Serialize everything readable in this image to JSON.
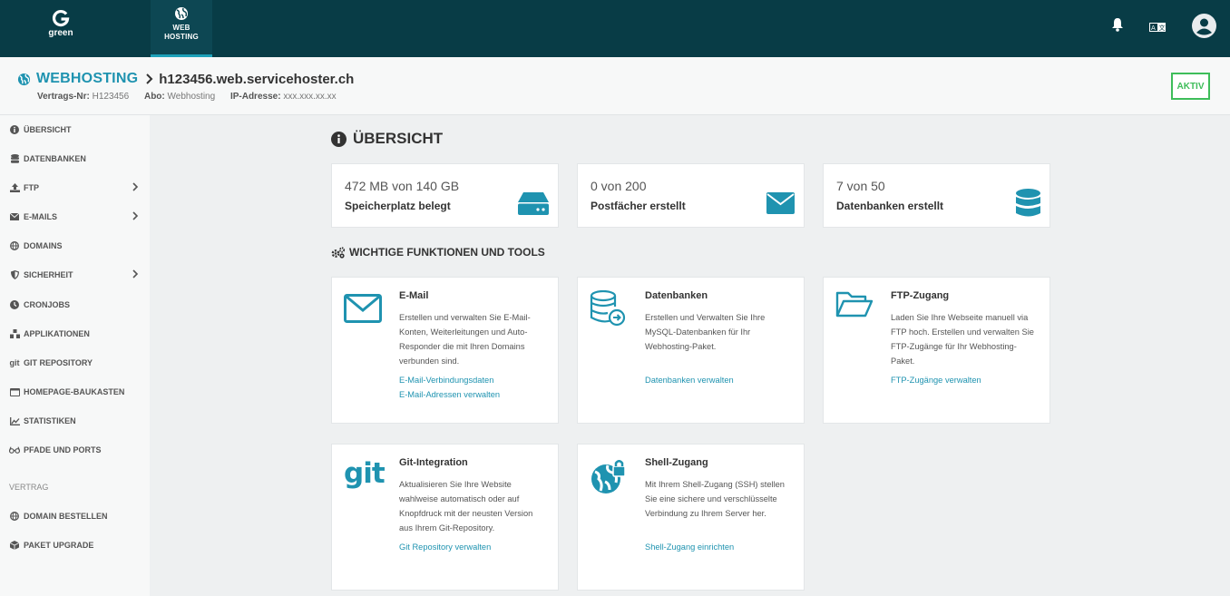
{
  "topbar": {
    "logo_text": "green",
    "nav_label_line1": "WEB",
    "nav_label_line2": "HOSTING"
  },
  "header": {
    "root": "WEBHOSTING",
    "host": "h123456.web.servicehoster.ch",
    "contract_label": "Vertrags-Nr:",
    "contract_value": "H123456",
    "abo_label": "Abo:",
    "abo_value": "Webhosting",
    "ip_label": "IP-Adresse:",
    "ip_value": "xxx.xxx.xx.xx",
    "status": "AKTIV"
  },
  "sidebar": {
    "items": [
      {
        "label": "ÜBERSICHT",
        "icon": "info-icon"
      },
      {
        "label": "DATENBANKEN",
        "icon": "database-icon"
      },
      {
        "label": "FTP",
        "icon": "upload-icon"
      },
      {
        "label": "E-MAILS",
        "icon": "envelope-icon"
      },
      {
        "label": "DOMAINS",
        "icon": "globe-icon"
      },
      {
        "label": "SICHERHEIT",
        "icon": "shield-icon"
      },
      {
        "label": "CRONJOBS",
        "icon": "clock-icon"
      },
      {
        "label": "APPLIKATIONEN",
        "icon": "apps-icon"
      },
      {
        "label": "GIT REPOSITORY",
        "icon": "git-icon"
      },
      {
        "label": "HOMEPAGE-BAUKASTEN",
        "icon": "window-icon"
      },
      {
        "label": "STATISTIKEN",
        "icon": "chart-icon"
      },
      {
        "label": "PFADE UND PORTS",
        "icon": "glasses-icon"
      }
    ],
    "group_label": "VERTRAG",
    "contract_items": [
      {
        "label": "DOMAIN BESTELLEN",
        "icon": "globe-icon"
      },
      {
        "label": "PAKET UPGRADE",
        "icon": "box-icon"
      }
    ]
  },
  "main": {
    "title": "ÜBERSICHT",
    "stats": [
      {
        "value": "472 MB von 140 GB",
        "label": "Speicherplatz belegt",
        "icon": "hdd-icon"
      },
      {
        "value": "0 von 200",
        "label": "Postfächer erstellt",
        "icon": "envelope-icon"
      },
      {
        "value": "7 von 50",
        "label": "Datenbanken erstellt",
        "icon": "database-icon"
      }
    ],
    "tools_title": "WICHTIGE FUNKTIONEN UND TOOLS",
    "cards": [
      {
        "title": "E-Mail",
        "desc": "Erstellen und verwalten Sie E-Mail-Konten, Weiterleitungen und Auto-Responder die mit Ihren Domains verbunden sind.",
        "links": [
          "E-Mail-Verbindungsdaten",
          "E-Mail-Adressen verwalten"
        ]
      },
      {
        "title": "Datenbanken",
        "desc": "Erstellen und Verwalten Sie Ihre MySQL-Datenbanken für Ihr Webhosting-Paket.",
        "links": [
          "Datenbanken verwalten"
        ]
      },
      {
        "title": "FTP-Zugang",
        "desc": "Laden Sie Ihre Webseite manuell via FTP hoch. Erstellen und verwalten Sie FTP-Zugänge für Ihr Webhosting-Paket.",
        "links": [
          "FTP-Zugänge verwalten"
        ]
      },
      {
        "title": "Git-Integration",
        "desc": "Aktualisieren Sie Ihre Website wahlweise automatisch oder auf Knopfdruck mit der neusten Version aus Ihrem Git-Repository.",
        "links": [
          "Git Repository verwalten"
        ],
        "icon_text": "git"
      },
      {
        "title": "Shell-Zugang",
        "desc": "Mit Ihrem Shell-Zugang (SSH) stellen Sie eine sichere und verschlüsselte Verbindung zu Ihrem Server her.",
        "links": [
          "Shell-Zugang einrichten"
        ]
      }
    ]
  },
  "colors": {
    "accent": "#1f93b0",
    "topbar": "#083c46",
    "status": "#3ebd5a"
  }
}
